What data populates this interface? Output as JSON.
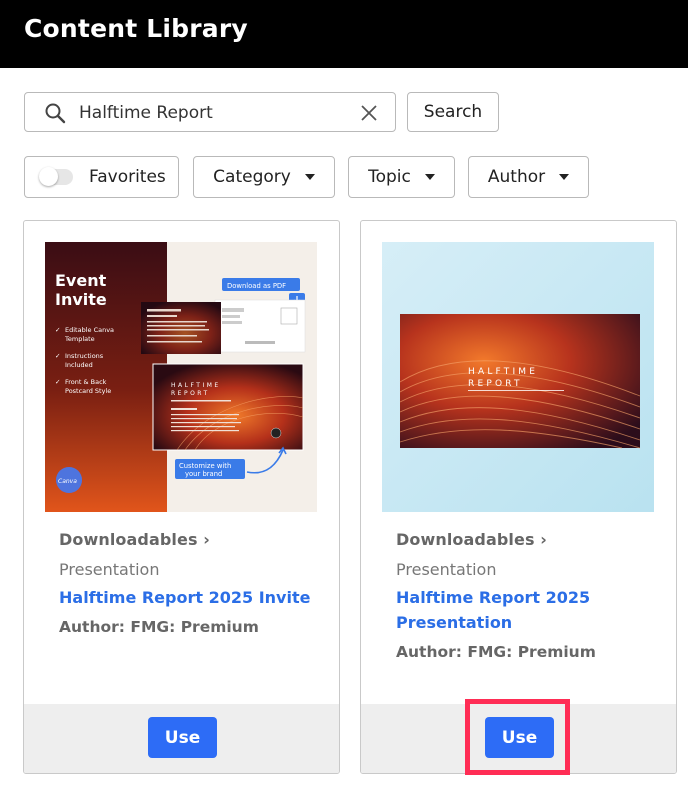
{
  "header": {
    "title": "Content Library"
  },
  "search": {
    "value": "Halftime Report",
    "button_label": "Search"
  },
  "filters": {
    "favorites_label": "Favorites",
    "favorites_on": false,
    "category_label": "Category",
    "topic_label": "Topic",
    "author_label": "Author"
  },
  "cards": [
    {
      "breadcrumb": "Downloadables ›",
      "subcategory": "Presentation",
      "title": "Halftime Report 2025 Invite",
      "author": "Author: FMG: Premium",
      "use_label": "Use",
      "thumb": {
        "heading_line1": "Event",
        "heading_line2": "Invite",
        "checks": [
          "Editable Canva Template",
          "Instructions Included",
          "Front & Back Postcard Style"
        ],
        "download_label": "Download as PDF",
        "customize_label": "Customize with your brand",
        "canva_badge": "Canva",
        "card_title_line1": "HALFTIME",
        "card_title_line2": "REPORT"
      }
    },
    {
      "breadcrumb": "Downloadables ›",
      "subcategory": "Presentation",
      "title": "Halftime Report 2025 Presentation",
      "author": "Author: FMG: Premium",
      "use_label": "Use",
      "thumb": {
        "slide_title_line1": "HALFTIME",
        "slide_title_line2": "REPORT"
      }
    }
  ],
  "colors": {
    "accent_blue": "#2d6cf6",
    "link_blue": "#2b6ee6",
    "highlight": "#ff2d55",
    "header_bg": "#000000"
  }
}
